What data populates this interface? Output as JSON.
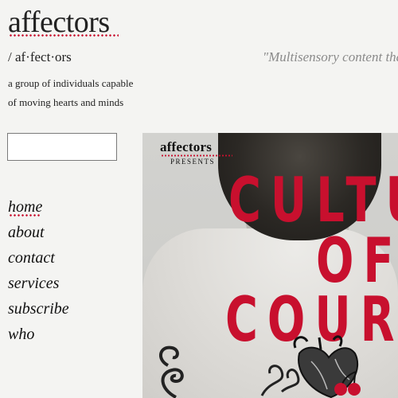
{
  "site": {
    "brand": "affectors",
    "pronunciation": "/ af·fect·ors",
    "tagline": "\"Multisensory content tha",
    "description_line1": "a group of individuals capable",
    "description_line2": "of moving hearts and minds"
  },
  "search": {
    "value": "",
    "placeholder": ""
  },
  "nav": {
    "items": [
      {
        "label": "home",
        "active": true
      },
      {
        "label": "about"
      },
      {
        "label": "contact"
      },
      {
        "label": "services"
      },
      {
        "label": "subscribe"
      },
      {
        "label": "who"
      }
    ]
  },
  "poster": {
    "brand": "affectors",
    "presents": "PRESENTS",
    "line1": "CULTU",
    "line2": "OF",
    "line3": "COURA"
  },
  "colors": {
    "accent": "#c8102e",
    "text": "#1a1a1a",
    "tagline": "#8a8a8a",
    "background": "#f4f4f2"
  }
}
